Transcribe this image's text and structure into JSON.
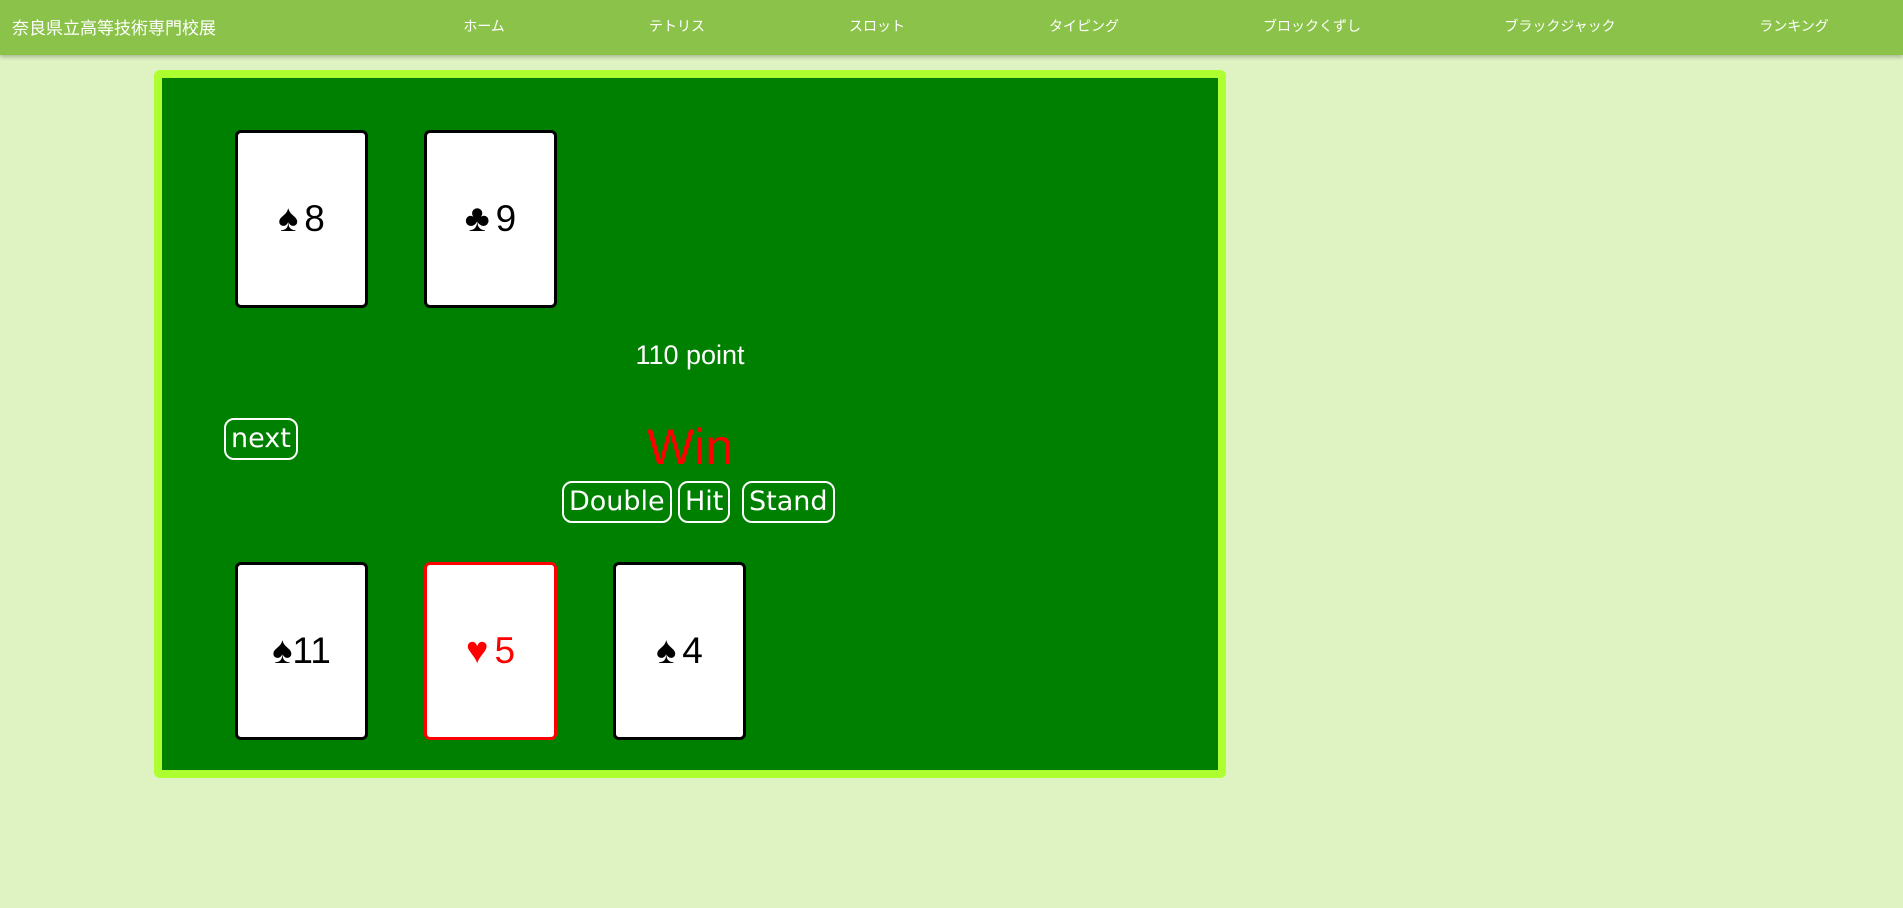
{
  "header": {
    "title": "奈良県立高等技術専門校展",
    "nav": [
      {
        "label": "ホーム"
      },
      {
        "label": "テトリス"
      },
      {
        "label": "スロット"
      },
      {
        "label": "タイピング"
      },
      {
        "label": "ブロックくずし"
      },
      {
        "label": "ブラックジャック"
      },
      {
        "label": "ランキング"
      }
    ]
  },
  "game": {
    "dealer_cards": [
      {
        "suit_icon": "spade-icon",
        "suit": "♠",
        "rank": "8",
        "color": "#000000"
      },
      {
        "suit_icon": "club-icon",
        "suit": "♣",
        "rank": "9",
        "color": "#000000"
      }
    ],
    "player_cards": [
      {
        "suit_icon": "spade-icon",
        "suit": "♠",
        "rank": "11",
        "color": "#000000"
      },
      {
        "suit_icon": "heart-icon",
        "suit": "♥",
        "rank": "5",
        "color": "#ff0000"
      },
      {
        "suit_icon": "spade-icon",
        "suit": "♠",
        "rank": "4",
        "color": "#000000"
      }
    ],
    "points_text": "110 point",
    "result_text": "Win",
    "buttons": {
      "next": "next",
      "double": "Double",
      "hit": "Hit",
      "stand": "Stand"
    },
    "colors": {
      "felt": "#008000",
      "felt_border": "#adff2f",
      "result": "#ff0000",
      "header": "#8bc34a",
      "page_bg": "#dff2c2"
    }
  }
}
